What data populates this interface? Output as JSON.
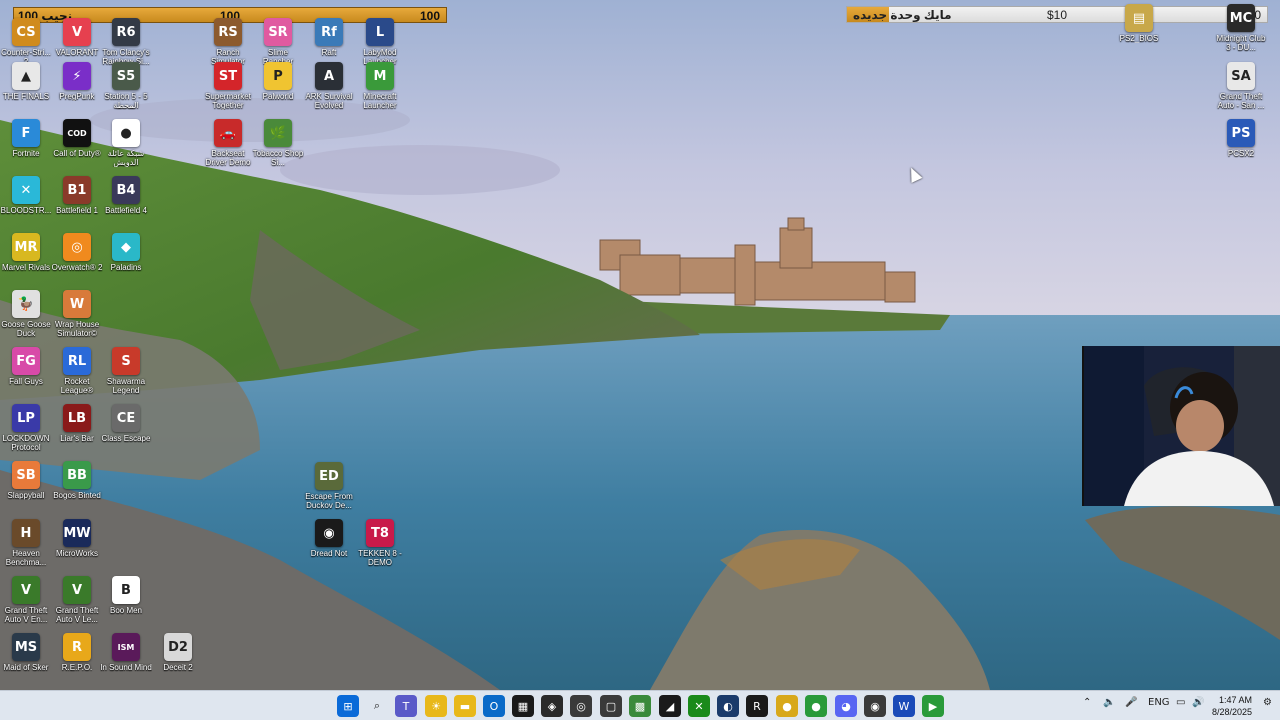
{
  "overlay": {
    "goal_bar": {
      "left": "100 نجيب",
      "mid": "100",
      "right": "100"
    },
    "donation_bar": {
      "label": "مايك وحدة جديده",
      "mid": "$10",
      "right": "$100",
      "progress": 0.1
    }
  },
  "desktop_icons": [
    {
      "id": "counter-strike",
      "label": "Counter-Stri... 2",
      "color": "#d08b1e",
      "glyph": "CS"
    },
    {
      "id": "valorant",
      "label": "VALORANT",
      "color": "#e6404f",
      "glyph": "V"
    },
    {
      "id": "rainbow-six",
      "label": "Tom Clancy's Rainbow Si...",
      "color": "#333a46",
      "glyph": "R6"
    },
    {
      "id": "ranch-simulator",
      "label": "Ranch Simulator",
      "color": "#8c5a2e",
      "glyph": "RS"
    },
    {
      "id": "slime-rancher",
      "label": "Slime Rancher",
      "color": "#e05aa0",
      "glyph": "SR"
    },
    {
      "id": "raft",
      "label": "Raft",
      "color": "#3a7ab8",
      "glyph": "Rf"
    },
    {
      "id": "labymod",
      "label": "LabyMod Launcher",
      "color": "#2a4a8a",
      "glyph": "L"
    },
    {
      "id": "the-finals",
      "label": "THE FINALS",
      "color": "#e8e8e8",
      "glyph": "▲"
    },
    {
      "id": "pregpunk",
      "label": "PregPunk",
      "color": "#7a2ec8",
      "glyph": "⚡"
    },
    {
      "id": "station-5",
      "label": "Station 5 - 5 المحطة",
      "color": "#4a5a4a",
      "glyph": "S5"
    },
    {
      "id": "supermarket",
      "label": "Supermarket Together",
      "color": "#d4252a",
      "glyph": "ST"
    },
    {
      "id": "palworld",
      "label": "Palworld",
      "color": "#f0c431",
      "glyph": "P"
    },
    {
      "id": "ark",
      "label": "ARK Survival Evolved",
      "color": "#2a2f36",
      "glyph": "A"
    },
    {
      "id": "minecraft",
      "label": "Minecraft Launcher",
      "color": "#3a9a3a",
      "glyph": "M"
    },
    {
      "id": "fortnite",
      "label": "Fortnite",
      "color": "#2a8ad8",
      "glyph": "F"
    },
    {
      "id": "cod",
      "label": "Call of Duty®",
      "color": "#111111",
      "glyph": "COD"
    },
    {
      "id": "chrome-shortcut",
      "label": "شبكة عائلة الدويش",
      "color": "#ffffff",
      "glyph": "●"
    },
    {
      "id": "backseat-driver",
      "label": "Backseat Driver Demo",
      "color": "#c82a2a",
      "glyph": "🚗"
    },
    {
      "id": "tobacco-shop",
      "label": "Tobacco Shop Si...",
      "color": "#4a8a3a",
      "glyph": "🌿"
    },
    {
      "id": "bloodstrike",
      "label": "BLOODSTR...",
      "color": "#2ab8d8",
      "glyph": "✕"
    },
    {
      "id": "battlefield-1",
      "label": "Battlefield 1",
      "color": "#8a3a2a",
      "glyph": "B1"
    },
    {
      "id": "battlefield-4",
      "label": "Battlefield 4",
      "color": "#3a3a5a",
      "glyph": "B4"
    },
    {
      "id": "marvel-rivals",
      "label": "Marvel Rivals",
      "color": "#d8b820",
      "glyph": "MR"
    },
    {
      "id": "overwatch",
      "label": "Overwatch® 2",
      "color": "#f08a1e",
      "glyph": "◎"
    },
    {
      "id": "paladins",
      "label": "Paladins",
      "color": "#2ab8c8",
      "glyph": "◆"
    },
    {
      "id": "goose",
      "label": "Goose Goose Duck",
      "color": "#e0e0e0",
      "glyph": "🦆"
    },
    {
      "id": "wrap-house",
      "label": "Wrap House Simulator©",
      "color": "#d87a3a",
      "glyph": "W"
    },
    {
      "id": "fall-guys",
      "label": "Fall Guys",
      "color": "#d84aa8",
      "glyph": "FG"
    },
    {
      "id": "rocket-league",
      "label": "Rocket League®",
      "color": "#2a6ad8",
      "glyph": "RL"
    },
    {
      "id": "shawarma",
      "label": "Shawarma Legend",
      "color": "#c83a2a",
      "glyph": "S"
    },
    {
      "id": "lockdown",
      "label": "LOCKDOWN Protocol",
      "color": "#3a3aa8",
      "glyph": "LP"
    },
    {
      "id": "liars-bar",
      "label": "Liar's Bar",
      "color": "#8a1a1a",
      "glyph": "LB"
    },
    {
      "id": "class-escape",
      "label": "Class Escape",
      "color": "#6a6a6a",
      "glyph": "CE"
    },
    {
      "id": "slappyball",
      "label": "Slappyball",
      "color": "#e87a3a",
      "glyph": "SB"
    },
    {
      "id": "bogos-binted",
      "label": "Bogos Binted",
      "color": "#3a9a4a",
      "glyph": "BB"
    },
    {
      "id": "escape-duckov",
      "label": "Escape From Duckov De...",
      "color": "#5a6a3a",
      "glyph": "ED"
    },
    {
      "id": "heaven-bench",
      "label": "Heaven Benchma...",
      "color": "#6a4a2a",
      "glyph": "H"
    },
    {
      "id": "microworks",
      "label": "MicroWorks",
      "color": "#1a2a5a",
      "glyph": "MW"
    },
    {
      "id": "dread-not",
      "label": "Dread Not",
      "color": "#1a1a1a",
      "glyph": "◉"
    },
    {
      "id": "tekken",
      "label": "TEKKEN 8 - DEMO",
      "color": "#c81a4a",
      "glyph": "T8"
    },
    {
      "id": "gta-v-1",
      "label": "Grand Theft Auto V En...",
      "color": "#3a7a2a",
      "glyph": "V"
    },
    {
      "id": "gta-v-2",
      "label": "Grand Theft Auto V Le...",
      "color": "#3a7a2a",
      "glyph": "V"
    },
    {
      "id": "boo-men",
      "label": "Boo Men",
      "color": "#ffffff",
      "glyph": "B"
    },
    {
      "id": "maid-of-sker",
      "label": "Maid of Sker",
      "color": "#2a3a4a",
      "glyph": "MS"
    },
    {
      "id": "repo",
      "label": "R.E.P.O.",
      "color": "#e8a81a",
      "glyph": "R"
    },
    {
      "id": "in-sound-mind",
      "label": "In Sound Mind",
      "color": "#5a1a5a",
      "glyph": "ISM"
    },
    {
      "id": "deceit-2",
      "label": "Deceit 2",
      "color": "#d8d8d8",
      "glyph": "D2"
    },
    {
      "id": "ps2-bios",
      "label": "PS2_BIOS",
      "color": "#c8a84a",
      "glyph": "▤"
    },
    {
      "id": "midnight-club",
      "label": "Midnight Club 3 - DU...",
      "color": "#2a2a2a",
      "glyph": "MC"
    },
    {
      "id": "gta-sa",
      "label": "Grand Theft Auto - San ...",
      "color": "#e8e8e8",
      "glyph": "SA"
    },
    {
      "id": "pcsx2",
      "label": "PCSX2",
      "color": "#2a5ab8",
      "glyph": "PS"
    }
  ],
  "taskbar": {
    "apps": [
      {
        "id": "start",
        "glyph": "⊞",
        "color": "#0a6ad8"
      },
      {
        "id": "search",
        "glyph": "⌕",
        "color": "#3a3a3a"
      },
      {
        "id": "teams",
        "glyph": "T",
        "color": "#5a5ac8"
      },
      {
        "id": "widgets",
        "glyph": "☀",
        "color": "#e8b81a"
      },
      {
        "id": "file-explorer",
        "glyph": "▬",
        "color": "#e8b81a"
      },
      {
        "id": "outlook",
        "glyph": "O",
        "color": "#0a6ac8"
      },
      {
        "id": "store",
        "glyph": "▦",
        "color": "#1a1a1a"
      },
      {
        "id": "epic",
        "glyph": "◈",
        "color": "#2a2a2a"
      },
      {
        "id": "ea-app",
        "glyph": "◎",
        "color": "#3a3a3a"
      },
      {
        "id": "notepad",
        "glyph": "▢",
        "color": "#3a3a3a"
      },
      {
        "id": "minecraft-tb",
        "glyph": "▩",
        "color": "#3a8a3a"
      },
      {
        "id": "cursor-app",
        "glyph": "◢",
        "color": "#1a1a1a"
      },
      {
        "id": "xbox",
        "glyph": "✕",
        "color": "#1a8a1a"
      },
      {
        "id": "steam",
        "glyph": "◐",
        "color": "#1a3a6a"
      },
      {
        "id": "rockstar",
        "glyph": "R",
        "color": "#1a1a1a"
      },
      {
        "id": "chrome-1",
        "glyph": "●",
        "color": "#d8a81a"
      },
      {
        "id": "chrome-2",
        "glyph": "●",
        "color": "#2a9a3a"
      },
      {
        "id": "discord",
        "glyph": "◕",
        "color": "#5865f2"
      },
      {
        "id": "obs",
        "glyph": "◉",
        "color": "#3a3a3a"
      },
      {
        "id": "app-blue",
        "glyph": "W",
        "color": "#1a4ab8"
      },
      {
        "id": "app-green",
        "glyph": "▶",
        "color": "#2a9a3a"
      }
    ],
    "tray": {
      "lang": "ENG",
      "time": "1:47 AM",
      "date": "8/28/2025"
    }
  },
  "colors": {
    "goal_bar": "#e0a030",
    "taskbar": "#dfe6ef",
    "sky_top": "#a7b7d6",
    "sea": "#4f89a8"
  }
}
